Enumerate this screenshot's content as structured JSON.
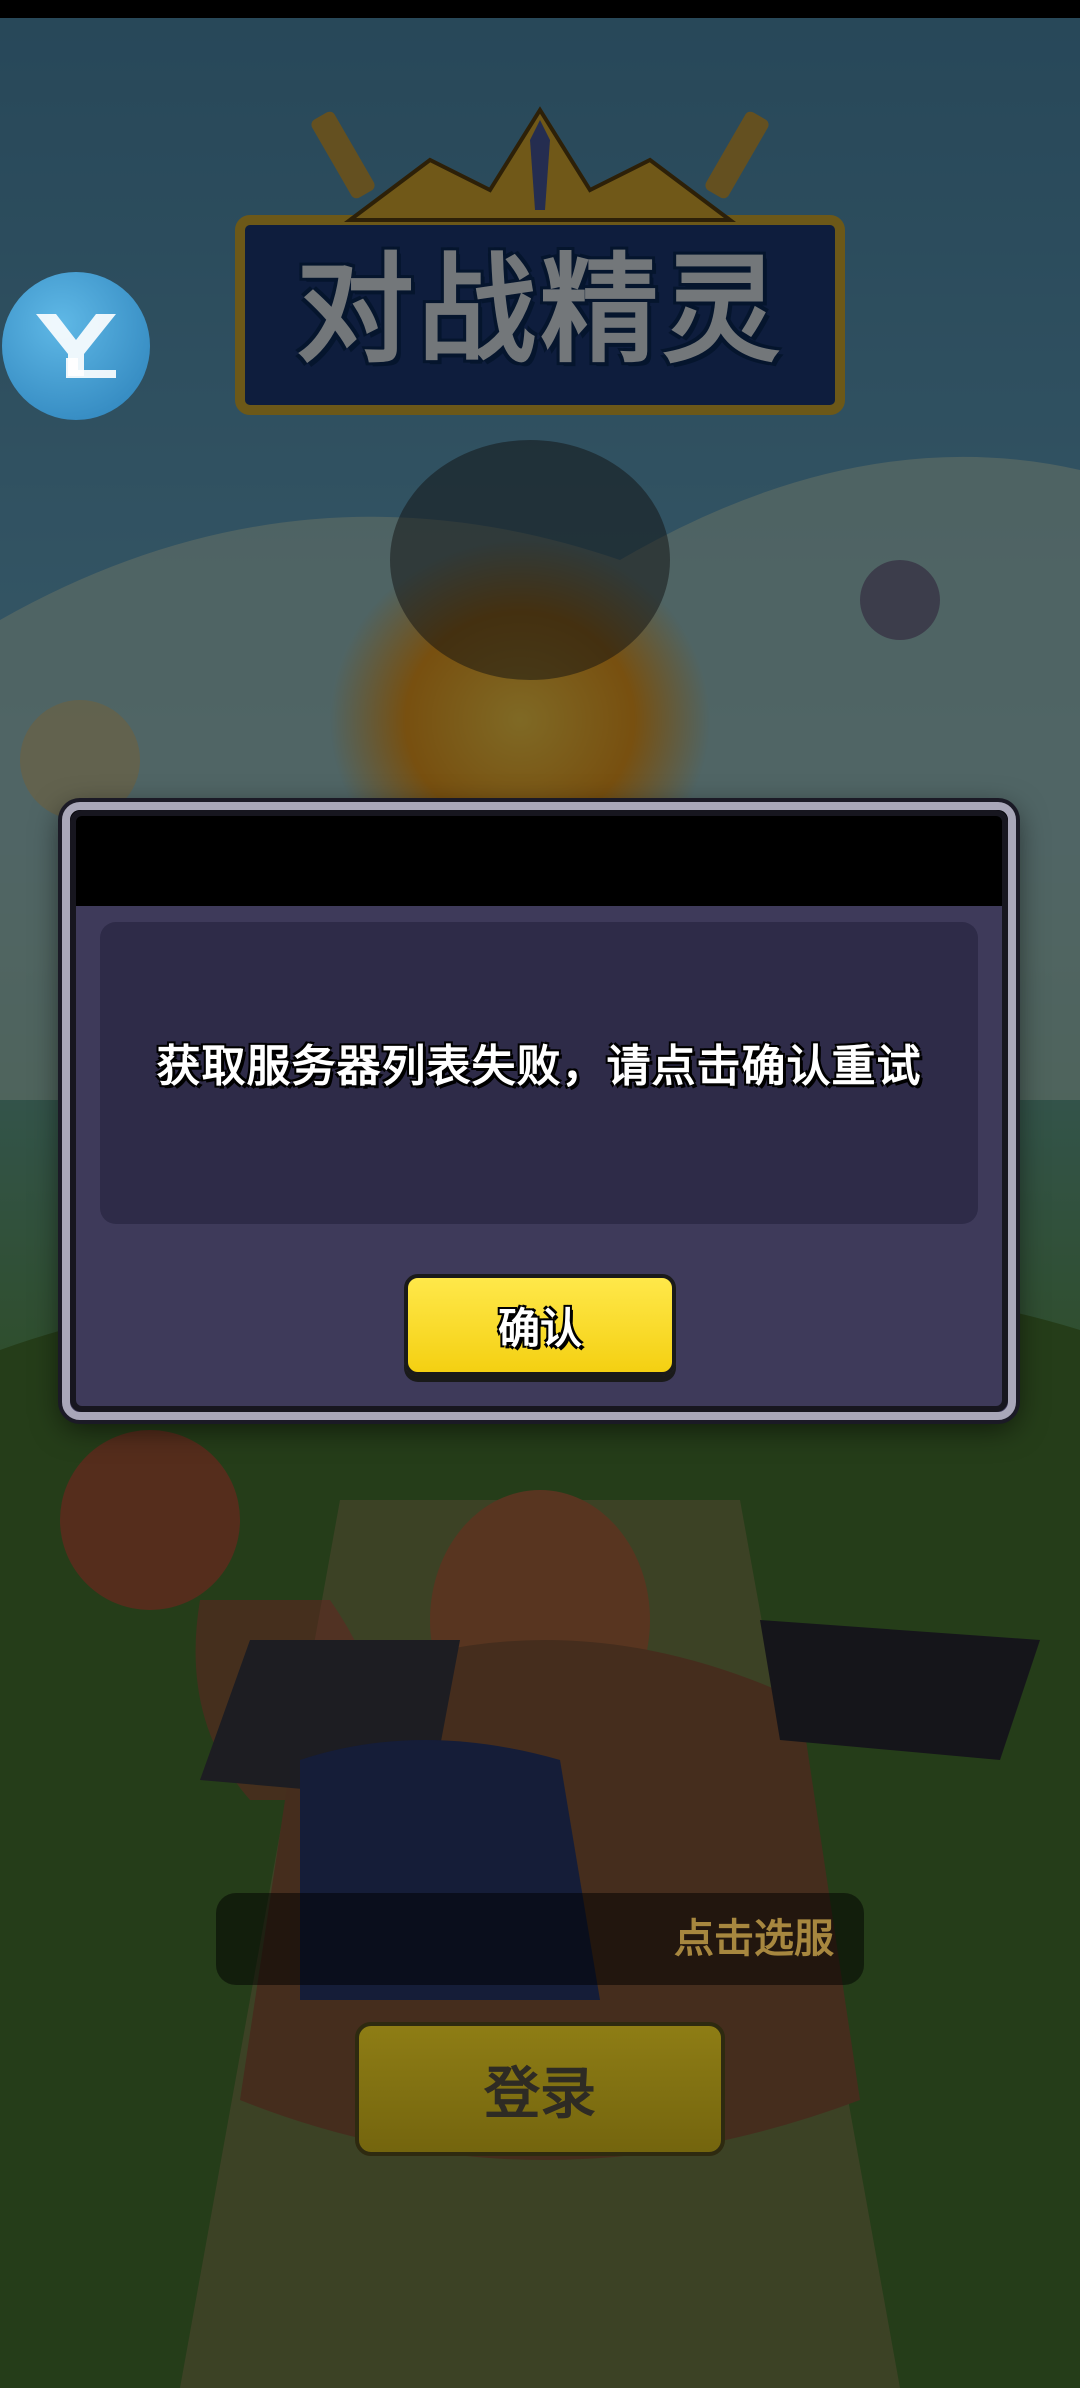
{
  "game": {
    "title": "对战精灵",
    "server_select_label": "点击选服",
    "login_label": "登录"
  },
  "dialog": {
    "message": "获取服务器列表失败，请点击确认重试",
    "confirm_label": "确认"
  },
  "icons": {
    "avatar": "yl-logo-icon",
    "sword_left": "sword-icon",
    "sword_right": "sword-icon",
    "crown": "crown-icon"
  },
  "colors": {
    "dialog_bg": "#3e3a5a",
    "message_bg": "#2e2b48",
    "confirm_button": "#f4d012",
    "login_button": "#8e7d15",
    "avatar": "#3a93c8"
  }
}
